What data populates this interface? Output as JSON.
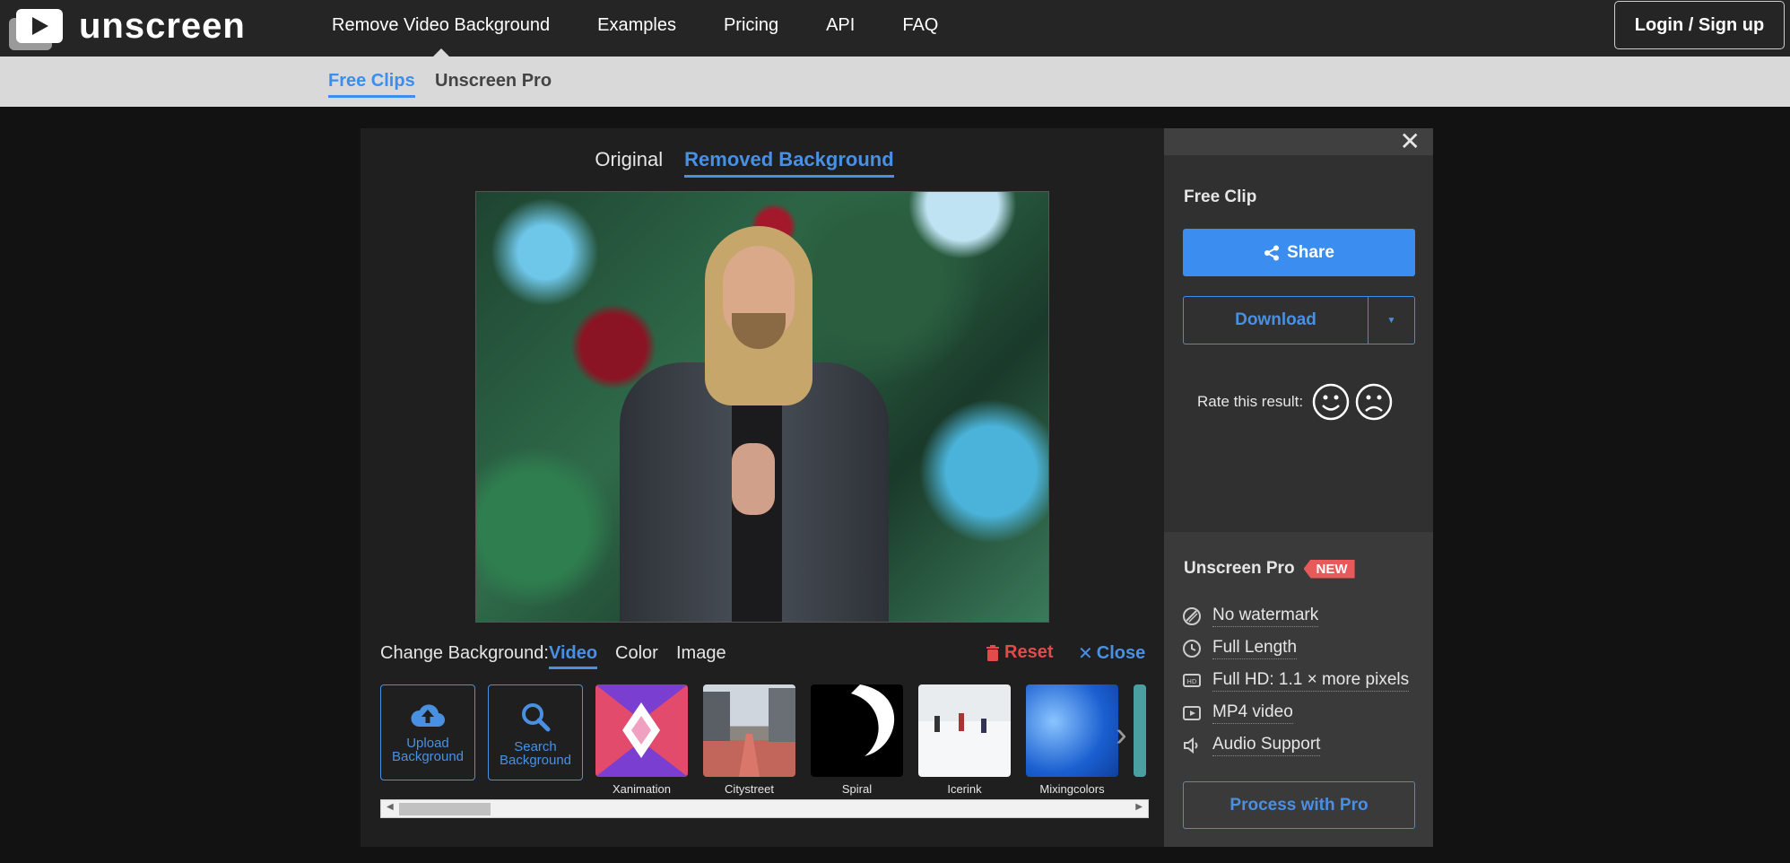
{
  "brand": {
    "name": "unscreen"
  },
  "nav": {
    "items": [
      {
        "label": "Remove Video Background"
      },
      {
        "label": "Examples"
      },
      {
        "label": "Pricing"
      },
      {
        "label": "API"
      },
      {
        "label": "FAQ"
      }
    ],
    "login_label": "Login / Sign up"
  },
  "subnav": {
    "free_clips": "Free Clips",
    "pro": "Unscreen Pro"
  },
  "editor": {
    "view_tabs": {
      "original": "Original",
      "removed": "Removed Background"
    },
    "change_bg_label": "Change Background:",
    "bg_tabs": {
      "video": "Video",
      "color": "Color",
      "image": "Image"
    },
    "reset_label": "Reset",
    "close_label": "Close",
    "upload_btn": "Upload Background",
    "search_btn": "Search Background",
    "thumbnails": [
      {
        "name": "Xanimation"
      },
      {
        "name": "Citystreet"
      },
      {
        "name": "Spiral"
      },
      {
        "name": "Icerink"
      },
      {
        "name": "Mixingcolors"
      }
    ]
  },
  "sidebar": {
    "title": "Free Clip",
    "share_label": "Share",
    "download_label": "Download",
    "rate_label": "Rate this result:",
    "pro_title": "Unscreen Pro",
    "new_badge": "NEW",
    "features": [
      {
        "icon": "no-watermark-icon",
        "label": "No watermark"
      },
      {
        "icon": "clock-icon",
        "label": "Full Length"
      },
      {
        "icon": "hd-icon",
        "label": "Full HD: 1.1 × more pixels"
      },
      {
        "icon": "play-icon",
        "label": "MP4 video"
      },
      {
        "icon": "speaker-icon",
        "label": "Audio Support"
      }
    ],
    "process_label": "Process with Pro"
  },
  "colors": {
    "accent": "#3b8ef0",
    "danger": "#e24b4b",
    "topbar": "#252525",
    "subnav": "#d9d9d9"
  }
}
